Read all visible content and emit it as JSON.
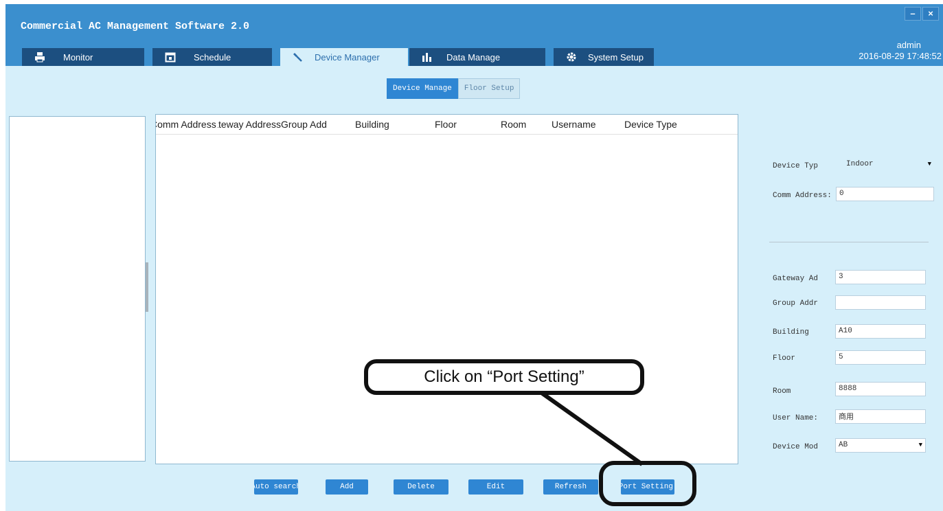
{
  "app": {
    "title": "Commercial AC Management Software 2.0"
  },
  "window_controls": {
    "minimize": "–",
    "close": "×"
  },
  "tabs": [
    {
      "label": "Monitor",
      "icon": "printer-icon"
    },
    {
      "label": "Schedule",
      "icon": "calendar-icon"
    },
    {
      "label": "Device Manager",
      "icon": "wrench-icon"
    },
    {
      "label": "Data Manage",
      "icon": "bar-chart-icon"
    },
    {
      "label": "System Setup",
      "icon": "gear-icon"
    }
  ],
  "user": {
    "name": "admin",
    "datetime": "2016-08-29 17:48:52"
  },
  "subtabs": [
    {
      "label": "Device Manage"
    },
    {
      "label": "Floor Setup"
    }
  ],
  "table": {
    "columns": [
      "Comm Address",
      "Gateway Address",
      "Group Add",
      "Building",
      "Floor",
      "Room",
      "Username",
      "Device Type"
    ]
  },
  "form": {
    "device_type": {
      "label": "Device Typ",
      "value": "Indoor"
    },
    "comm_address": {
      "label": "Comm Address:",
      "value": "0"
    },
    "gateway_address": {
      "label": "Gateway Ad",
      "value": "3"
    },
    "group_address": {
      "label": "Group Addr",
      "value": ""
    },
    "building": {
      "label": "Building",
      "value": "A10"
    },
    "floor": {
      "label": "Floor",
      "value": "5"
    },
    "room": {
      "label": "Room",
      "value": "8888"
    },
    "user_name": {
      "label": "User Name:",
      "value": "商用"
    },
    "device_model": {
      "label": "Device Mod",
      "value": "AB"
    }
  },
  "buttons": {
    "auto_search": "Auto search",
    "add": "Add",
    "delete": "Delete",
    "edit": "Edit",
    "refresh": "Refresh",
    "port_setting": "Port Setting"
  },
  "callout": {
    "text": "Click on “Port Setting”"
  }
}
